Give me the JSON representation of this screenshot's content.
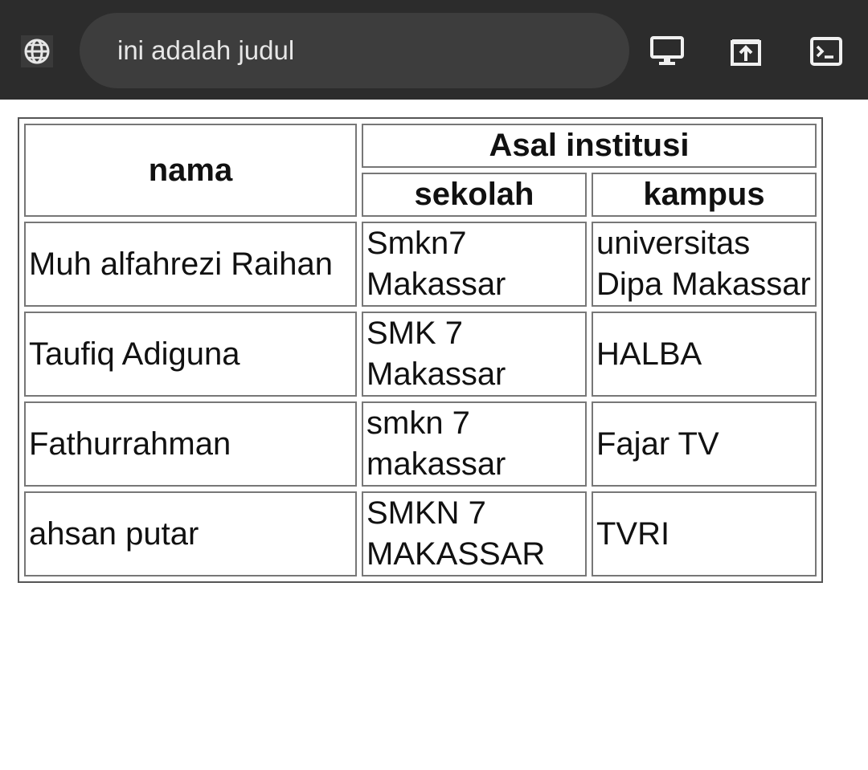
{
  "browser": {
    "globe_icon": "globe-icon",
    "title": "ini adalah judul",
    "icons": [
      "desktop-icon",
      "open-external-icon",
      "terminal-icon"
    ]
  },
  "table": {
    "header_nama": "nama",
    "header_group": "Asal institusi",
    "header_sekolah": "sekolah",
    "header_kampus": "kampus",
    "rows": [
      {
        "nama": "Muh alfahrezi Raihan",
        "sekolah": "Smkn7 Makassar",
        "kampus": "universitas Dipa Makassar"
      },
      {
        "nama": "Taufiq Adiguna",
        "sekolah": "SMK 7 Makassar",
        "kampus": "HALBA"
      },
      {
        "nama": "Fathurrahman",
        "sekolah": "smkn 7 makassar",
        "kampus": "Fajar TV"
      },
      {
        "nama": "ahsan putar",
        "sekolah": "SMKN 7 MAKASSAR",
        "kampus": "TVRI"
      }
    ]
  }
}
